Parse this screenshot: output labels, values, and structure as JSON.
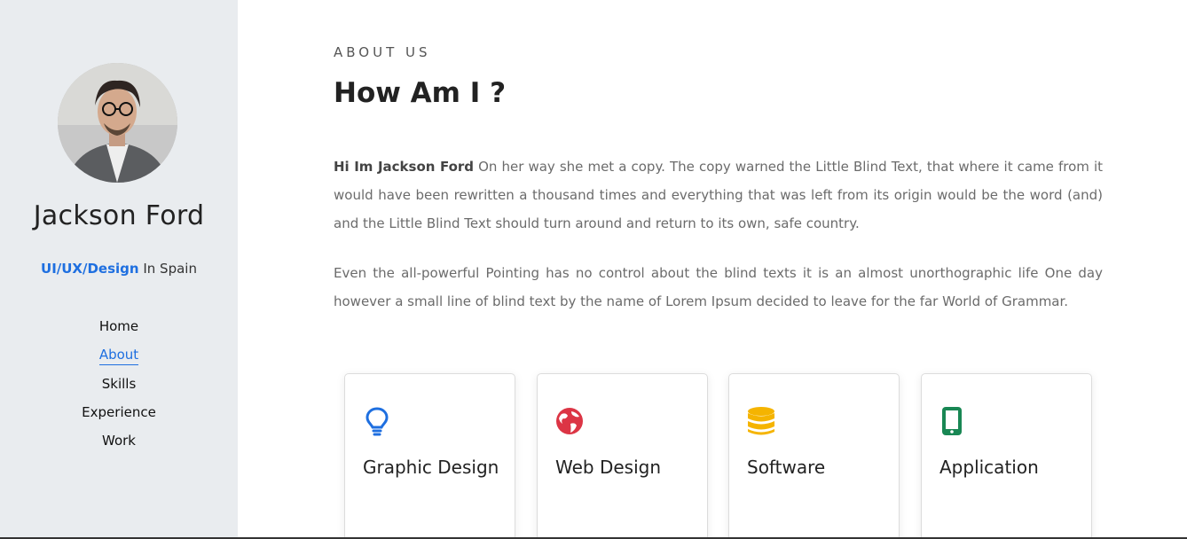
{
  "sidebar": {
    "name": "Jackson Ford",
    "role_accent": "UI/UX/Design",
    "role_rest": " In Spain",
    "nav": [
      {
        "label": "Home"
      },
      {
        "label": "About",
        "active": true
      },
      {
        "label": "Skills"
      },
      {
        "label": "Experience"
      },
      {
        "label": "Work"
      }
    ]
  },
  "main": {
    "eyebrow": "ABOUT US",
    "heading": "How Am I ?",
    "intro_bold": "Hi Im Jackson Ford",
    "intro_rest": " On her way she met a copy. The copy warned the Little Blind Text, that where it came from it would have been rewritten a thousand times and everything that was left from its origin would be the word (and) and the Little Blind Text should turn around and return to its own, safe country.",
    "para2": "Even the all-powerful Pointing has no control about the blind texts it is an almost unorthographic life One day however a small line of blind text by the name of Lorem Ipsum decided to leave for the far World of Grammar."
  },
  "cards": [
    {
      "label": "Graphic Design",
      "icon": "lightbulb-icon",
      "color": "#1e6fe0"
    },
    {
      "label": "Web Design",
      "icon": "globe-icon",
      "color": "#dc3545"
    },
    {
      "label": "Software",
      "icon": "database-icon",
      "color": "#f5b400"
    },
    {
      "label": "Application",
      "icon": "mobile-icon",
      "color": "#198754"
    }
  ],
  "colors": {
    "accent": "#1e6fe0",
    "sidebar_bg": "#e9ecef"
  }
}
